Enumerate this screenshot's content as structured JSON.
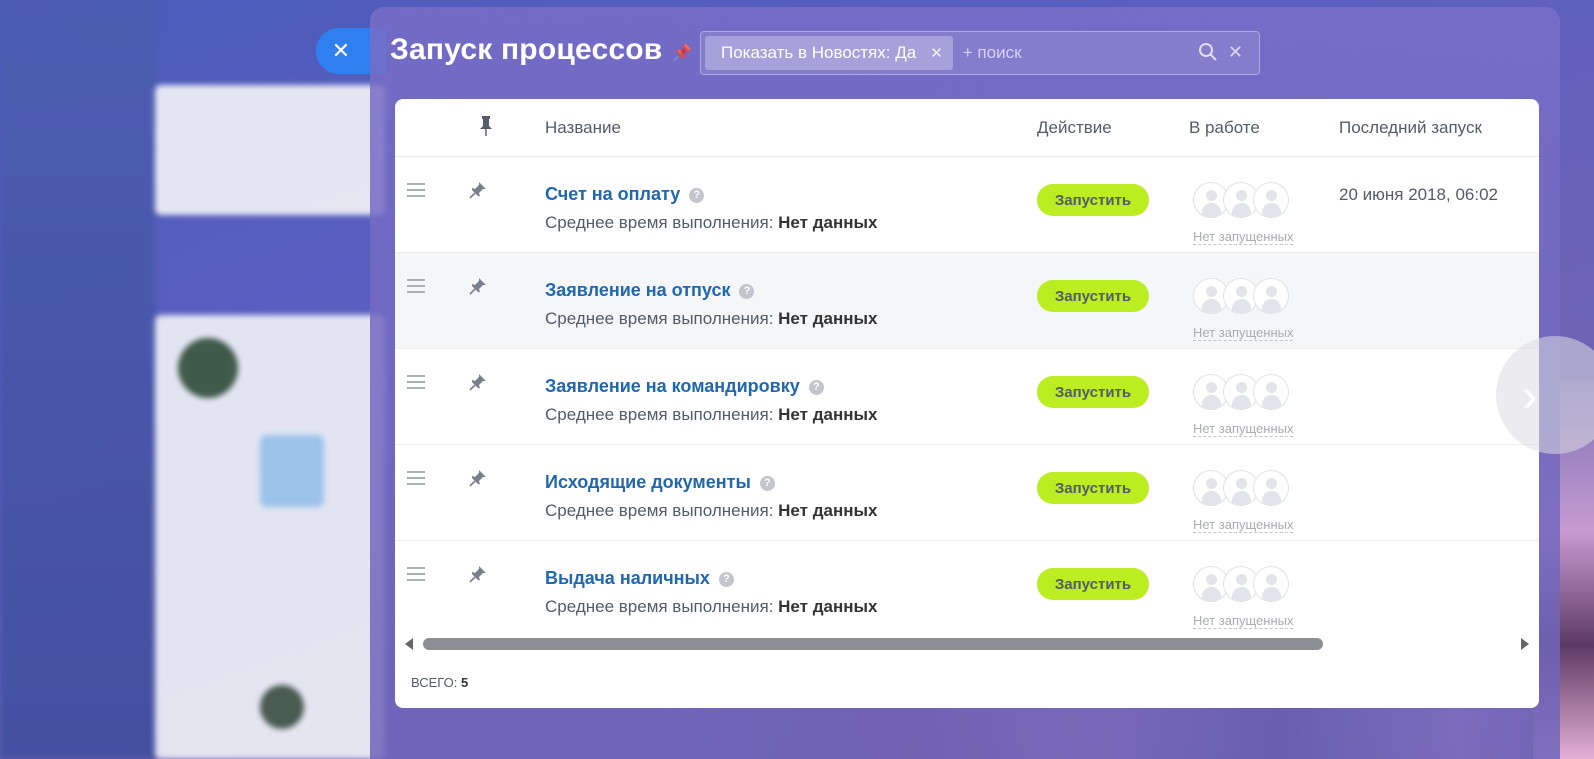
{
  "slider": {
    "title": "Запуск процессов",
    "close_glyph": "✕",
    "filter": {
      "chip_label": "Показать в Новостях: Да",
      "chip_close_glyph": "✕",
      "add_placeholder": "+ поиск",
      "search_glyph": "⚲",
      "clear_glyph": "✕"
    }
  },
  "grid": {
    "headers": {
      "pin": "📌",
      "name": "Название",
      "action": "Действие",
      "in_work": "В работе",
      "last_run": "Последний запуск"
    },
    "rows": [
      {
        "name": "Счет на оплату",
        "avg_label": "Среднее время выполнения:",
        "avg_value": "Нет данных",
        "button": "Запустить",
        "none_label": "Нет запущенных",
        "last_run": "20 июня 2018, 06:02"
      },
      {
        "name": "Заявление на отпуск",
        "avg_label": "Среднее время выполнения:",
        "avg_value": "Нет данных",
        "button": "Запустить",
        "none_label": "Нет запущенных",
        "last_run": ""
      },
      {
        "name": "Заявление на командировку",
        "avg_label": "Среднее время выполнения:",
        "avg_value": "Нет данных",
        "button": "Запустить",
        "none_label": "Нет запущенных",
        "last_run": ""
      },
      {
        "name": "Исходящие документы",
        "avg_label": "Среднее время выполнения:",
        "avg_value": "Нет данных",
        "button": "Запустить",
        "none_label": "Нет запущенных",
        "last_run": ""
      },
      {
        "name": "Выдача наличных",
        "avg_label": "Среднее время выполнения:",
        "avg_value": "Нет данных",
        "button": "Запустить",
        "none_label": "Нет запущенных",
        "last_run": ""
      }
    ],
    "help_glyph": "?",
    "footer_label": "ВСЕГО:",
    "footer_count": "5"
  },
  "nav": {
    "next_glyph": "›"
  },
  "colors": {
    "accent": "#2f7ff0",
    "run_button": "#bbed21",
    "link": "#2067b0"
  }
}
